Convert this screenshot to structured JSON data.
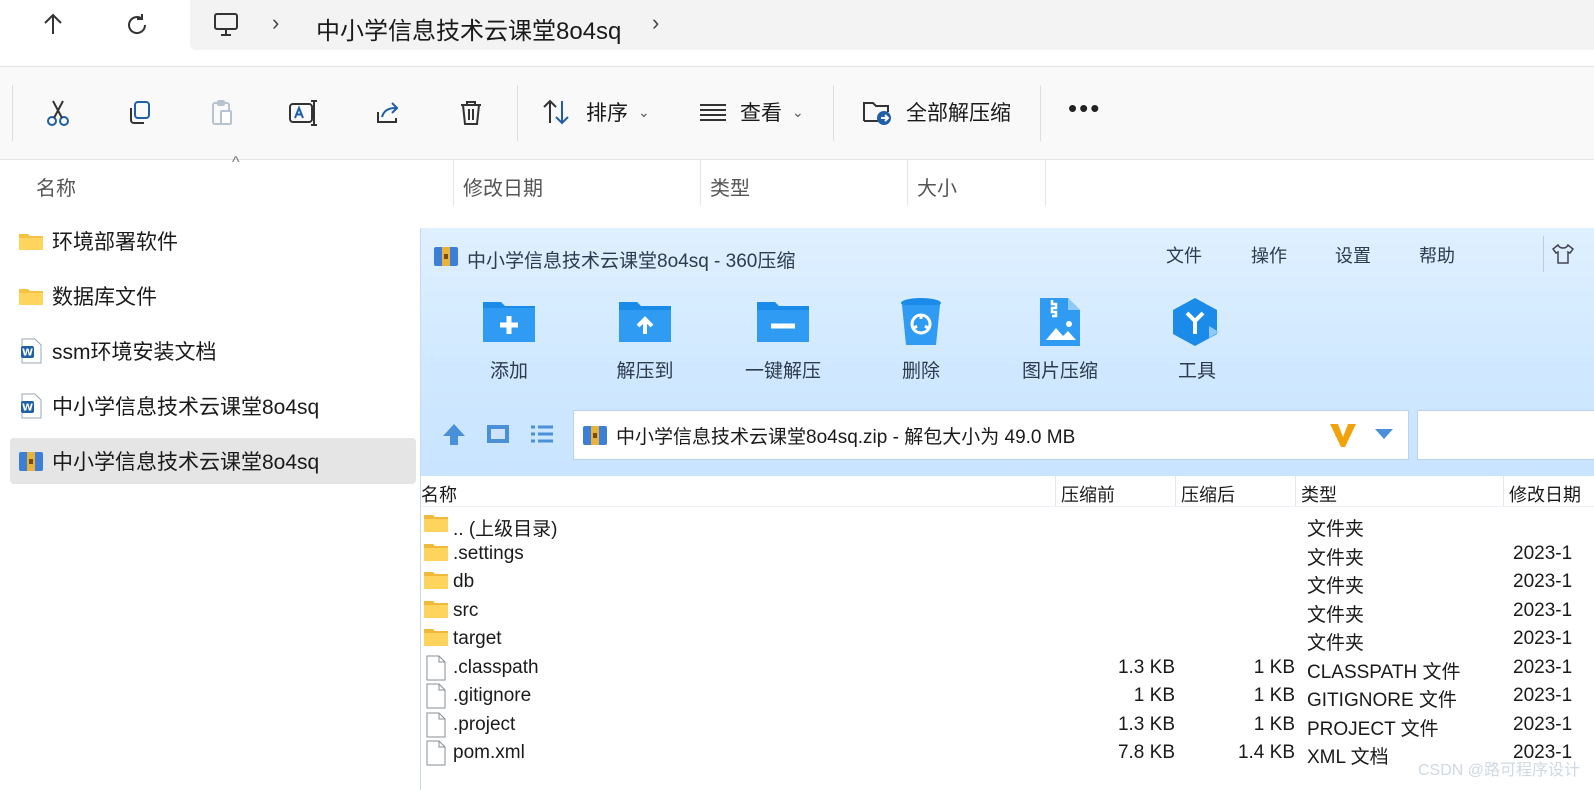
{
  "explorer": {
    "breadcrumb": "中小学信息技术云课堂8o4sq",
    "toolbar": {
      "sort_label": "排序",
      "view_label": "查看",
      "extract_all_label": "全部解压缩"
    },
    "columns": [
      "名称",
      "修改日期",
      "类型",
      "大小"
    ],
    "files": [
      {
        "name": "环境部署软件",
        "icon": "folder-icon"
      },
      {
        "name": "数据库文件",
        "icon": "folder-icon"
      },
      {
        "name": "ssm环境安装文档",
        "icon": "word-doc-icon"
      },
      {
        "name": "中小学信息技术云课堂8o4sq",
        "icon": "word-doc-icon"
      },
      {
        "name": "中小学信息技术云课堂8o4sq",
        "icon": "zip-archive-icon",
        "selected": true
      }
    ]
  },
  "archiver": {
    "title": "中小学信息技术云课堂8o4sq - 360压缩",
    "menu": [
      "文件",
      "操作",
      "设置",
      "帮助"
    ],
    "tools": [
      {
        "label": "添加",
        "icon": "add-folder-icon"
      },
      {
        "label": "解压到",
        "icon": "extract-to-icon"
      },
      {
        "label": "一键解压",
        "icon": "one-click-extract-icon"
      },
      {
        "label": "删除",
        "icon": "recycle-bin-icon"
      },
      {
        "label": "图片压缩",
        "icon": "image-compress-icon"
      },
      {
        "label": "工具",
        "icon": "tools-hex-icon"
      }
    ],
    "path": "中小学信息技术云课堂8o4sq.zip - 解包大小为 49.0 MB",
    "columns": [
      "名称",
      "压缩前",
      "压缩后",
      "类型",
      "修改日期"
    ],
    "rows": [
      {
        "name": ".. (上级目录)",
        "before": "",
        "after": "",
        "type": "文件夹",
        "date": "",
        "icon": "folder-icon"
      },
      {
        "name": ".settings",
        "before": "",
        "after": "",
        "type": "文件夹",
        "date": "2023-1",
        "icon": "folder-icon"
      },
      {
        "name": "db",
        "before": "",
        "after": "",
        "type": "文件夹",
        "date": "2023-1",
        "icon": "folder-icon"
      },
      {
        "name": "src",
        "before": "",
        "after": "",
        "type": "文件夹",
        "date": "2023-1",
        "icon": "folder-icon"
      },
      {
        "name": "target",
        "before": "",
        "after": "",
        "type": "文件夹",
        "date": "2023-1",
        "icon": "folder-icon"
      },
      {
        "name": ".classpath",
        "before": "1.3 KB",
        "after": "1 KB",
        "type": "CLASSPATH 文件",
        "date": "2023-1",
        "icon": "file-icon"
      },
      {
        "name": ".gitignore",
        "before": "1 KB",
        "after": "1 KB",
        "type": "GITIGNORE 文件",
        "date": "2023-1",
        "icon": "file-icon"
      },
      {
        "name": ".project",
        "before": "1.3 KB",
        "after": "1 KB",
        "type": "PROJECT 文件",
        "date": "2023-1",
        "icon": "file-icon"
      },
      {
        "name": "pom.xml",
        "before": "7.8 KB",
        "after": "1.4 KB",
        "type": "XML 文档",
        "date": "2023-1",
        "icon": "file-icon"
      }
    ]
  },
  "watermark": "CSDN @路可程序设计"
}
